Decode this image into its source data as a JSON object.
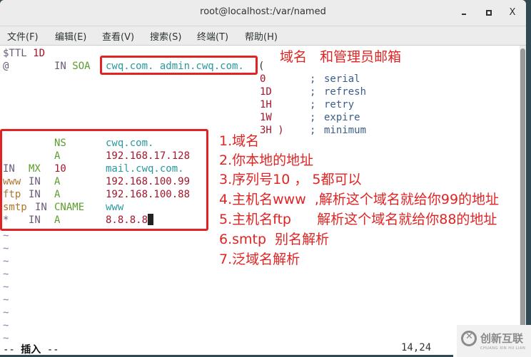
{
  "window": {
    "title": "root@localhost:/var/named",
    "minimize_label": "minimize",
    "maximize_label": "maximize",
    "close_label": "X"
  },
  "menu": [
    {
      "label": "文件(F)"
    },
    {
      "label": "编辑(E)"
    },
    {
      "label": "查看(V)"
    },
    {
      "label": "搜索(S)"
    },
    {
      "label": "终端(T)"
    },
    {
      "label": "帮助(H)"
    }
  ],
  "zone": {
    "ttl_directive": "$TTL",
    "ttl_value": "1D",
    "origin": "@",
    "soa_class": "IN",
    "soa_type": "SOA",
    "soa_mname_rname": "cwq.com. admin.cwq.com.",
    "soa_open": "(",
    "soa_fields": [
      {
        "value": "0",
        "comment": "serial"
      },
      {
        "value": "1D",
        "comment": "refresh"
      },
      {
        "value": "1H",
        "comment": "retry"
      },
      {
        "value": "1W",
        "comment": "expire"
      },
      {
        "value": "3H )",
        "comment": "minimum"
      }
    ],
    "comment_char": ";",
    "records": [
      {
        "name": "",
        "class": "",
        "type": "NS",
        "priority": "",
        "data": "cwq.com."
      },
      {
        "name": "",
        "class": "",
        "type": "A",
        "priority": "",
        "data": "192.168.17.128"
      },
      {
        "name": "",
        "class": "IN",
        "type": "MX",
        "priority": "10",
        "data": "mail.cwq.com."
      },
      {
        "name": "www",
        "class": "IN",
        "type": "A",
        "priority": "",
        "data": "192.168.100.99"
      },
      {
        "name": "ftp",
        "class": "IN",
        "type": "A",
        "priority": "",
        "data": "192.168.100.88"
      },
      {
        "name": "smtp",
        "class": "IN",
        "type": "CNAME",
        "priority": "",
        "data": "www"
      },
      {
        "name": "*",
        "class": "IN",
        "type": "A",
        "priority": "",
        "data": "8.8.8.8"
      }
    ],
    "empty_line_marker": "~"
  },
  "annotations": {
    "soa_note": "域名   和管理员邮箱",
    "notes": [
      "1.域名",
      "2.你本地的地址",
      "3.序列号10 ， 5都可以",
      "4.主机名www  ,解析这个域名就给你99的地址",
      "5.主机名ftp      解析这个域名就给你88的地址",
      "6.smtp  别名解析",
      "7.泛域名解析"
    ],
    "color": "#e02424"
  },
  "status": {
    "mode_prefix": "-- ",
    "mode": "插入",
    "mode_suffix": " --",
    "cursor_position": "14,24"
  },
  "watermark": {
    "text": "创新互联",
    "subtext": "CHUANG XIN HU LIAN"
  }
}
